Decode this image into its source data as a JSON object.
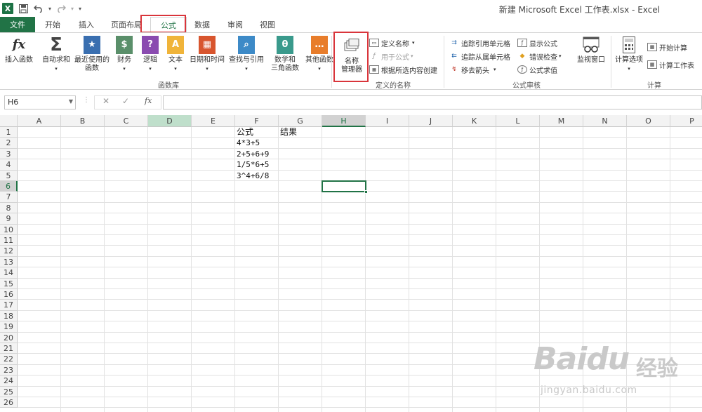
{
  "window": {
    "title": "新建 Microsoft Excel 工作表.xlsx - Excel"
  },
  "qat": {
    "logo_letter": "X",
    "save_icon": "save-icon",
    "undo_icon": "undo-icon",
    "redo_icon": "redo-icon",
    "customize_icon": "customize-qat-icon"
  },
  "tabs": [
    {
      "label": "文件"
    },
    {
      "label": "开始"
    },
    {
      "label": "插入"
    },
    {
      "label": "页面布局"
    },
    {
      "label": "公式"
    },
    {
      "label": "数据"
    },
    {
      "label": "审阅"
    },
    {
      "label": "视图"
    }
  ],
  "ribbon": {
    "function_library": {
      "group_label": "函数库",
      "insert_function": {
        "line1": "插入函数",
        "symbol": "fx",
        "icon": "function-icon"
      },
      "autosum": {
        "line1": "自动求和",
        "symbol": "Σ",
        "icon": "sigma-icon"
      },
      "recent": {
        "line1": "最近使用的",
        "line2": "函数",
        "symbol": "★",
        "icon": "star-book-icon"
      },
      "financial": {
        "line1": "财务",
        "symbol": "$",
        "icon": "financial-book-icon"
      },
      "logical": {
        "line1": "逻辑",
        "symbol": "?",
        "icon": "logical-book-icon"
      },
      "text": {
        "line1": "文本",
        "symbol": "A",
        "icon": "text-book-icon"
      },
      "datetime": {
        "line1": "日期和时间",
        "symbol": "▦",
        "icon": "calendar-book-icon"
      },
      "lookup": {
        "line1": "查找与引用",
        "symbol": "⌕",
        "icon": "lookup-book-icon"
      },
      "math": {
        "line1": "数学和",
        "line2": "三角函数",
        "symbol": "θ",
        "icon": "math-book-icon"
      },
      "more": {
        "line1": "其他函数",
        "symbol": "…",
        "icon": "more-functions-icon"
      }
    },
    "defined_names": {
      "group_label": "定义的名称",
      "name_manager": {
        "line1": "名称",
        "line2": "管理器",
        "icon": "name-manager-icon"
      },
      "define_name": "定义名称",
      "use_in_formula": "用于公式",
      "create_from_selection": "根据所选内容创建"
    },
    "formula_auditing": {
      "group_label": "公式审核",
      "trace_precedents": "追踪引用单元格",
      "trace_dependents": "追踪从属单元格",
      "remove_arrows": "移去箭头",
      "show_formulas": "显示公式",
      "error_checking": "错误检查",
      "evaluate_formula": "公式求值",
      "watch_window": "监视窗口"
    },
    "calculation": {
      "group_label": "计算",
      "options": "计算选项",
      "calc_now": "开始计算",
      "calc_sheet": "计算工作表"
    }
  },
  "formula_bar": {
    "name_box": "H6",
    "cancel": "✕",
    "enter": "✓",
    "fx": "fx",
    "value": ""
  },
  "sheet": {
    "columns": [
      "A",
      "B",
      "C",
      "D",
      "E",
      "F",
      "G",
      "H",
      "I",
      "J",
      "K",
      "L",
      "M",
      "N",
      "O",
      "P"
    ],
    "rows": [
      "1",
      "2",
      "3",
      "4",
      "5",
      "6",
      "7",
      "8",
      "9",
      "10",
      "11",
      "12",
      "13",
      "14",
      "15",
      "16",
      "17",
      "18",
      "19",
      "20",
      "21",
      "22",
      "23",
      "24",
      "25",
      "26"
    ],
    "selected_cell": "H6",
    "highlighted_column": "D",
    "cells": {
      "F1": "公式",
      "G1": "结果",
      "F2": "4*3+5",
      "F3": "2+5+6+9",
      "F4": "1/5*6+5",
      "F5": "3^4+6/8"
    }
  },
  "watermark": {
    "brand": "Baidu",
    "cn": "经验",
    "url": "jingyan.baidu.com"
  },
  "colors": {
    "excel_green": "#217346",
    "highlight_red": "#d9353b",
    "col_highlight": "#bfdfcb"
  }
}
